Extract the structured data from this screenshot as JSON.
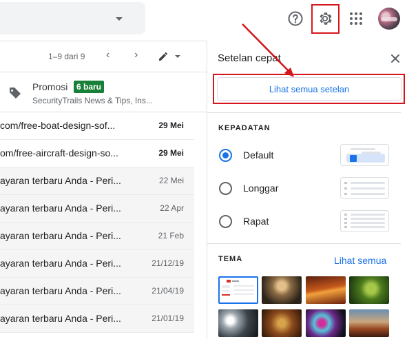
{
  "colors": {
    "accent": "#1a73e8",
    "highlight_red": "#d5161c",
    "badge_green": "#188038"
  },
  "header": {
    "icons": [
      "help-icon",
      "gear-icon",
      "apps-icon"
    ]
  },
  "list": {
    "pager_text": "1–9 dari 9",
    "promo": {
      "title": "Promosi",
      "badge": "6 baru",
      "snippet": "SecurityTrails News & Tips, Ins..."
    },
    "rows": [
      {
        "subject": "com/free-boat-design-sof...",
        "date": "29 Mei",
        "unread": true
      },
      {
        "subject": "om/free-aircraft-design-so...",
        "date": "29 Mei",
        "unread": true
      },
      {
        "subject": "ayaran terbaru Anda - Peri...",
        "date": "22 Mei",
        "unread": false
      },
      {
        "subject": "ayaran terbaru Anda - Peri...",
        "date": "22 Apr",
        "unread": false
      },
      {
        "subject": "ayaran terbaru Anda - Peri...",
        "date": "21 Feb",
        "unread": false
      },
      {
        "subject": "ayaran terbaru Anda - Peri...",
        "date": "21/12/19",
        "unread": false
      },
      {
        "subject": "ayaran terbaru Anda - Peri...",
        "date": "21/04/19",
        "unread": false
      },
      {
        "subject": "ayaran terbaru Anda - Peri...",
        "date": "21/01/19",
        "unread": false
      }
    ]
  },
  "quick_settings": {
    "title": "Setelan cepat",
    "see_all_settings": "Lihat semua setelan",
    "density": {
      "label": "KEPADATAN",
      "options": [
        "Default",
        "Longgar",
        "Rapat"
      ],
      "selected": "Default"
    },
    "theme": {
      "label": "TEMA",
      "see_all": "Lihat semua"
    }
  }
}
